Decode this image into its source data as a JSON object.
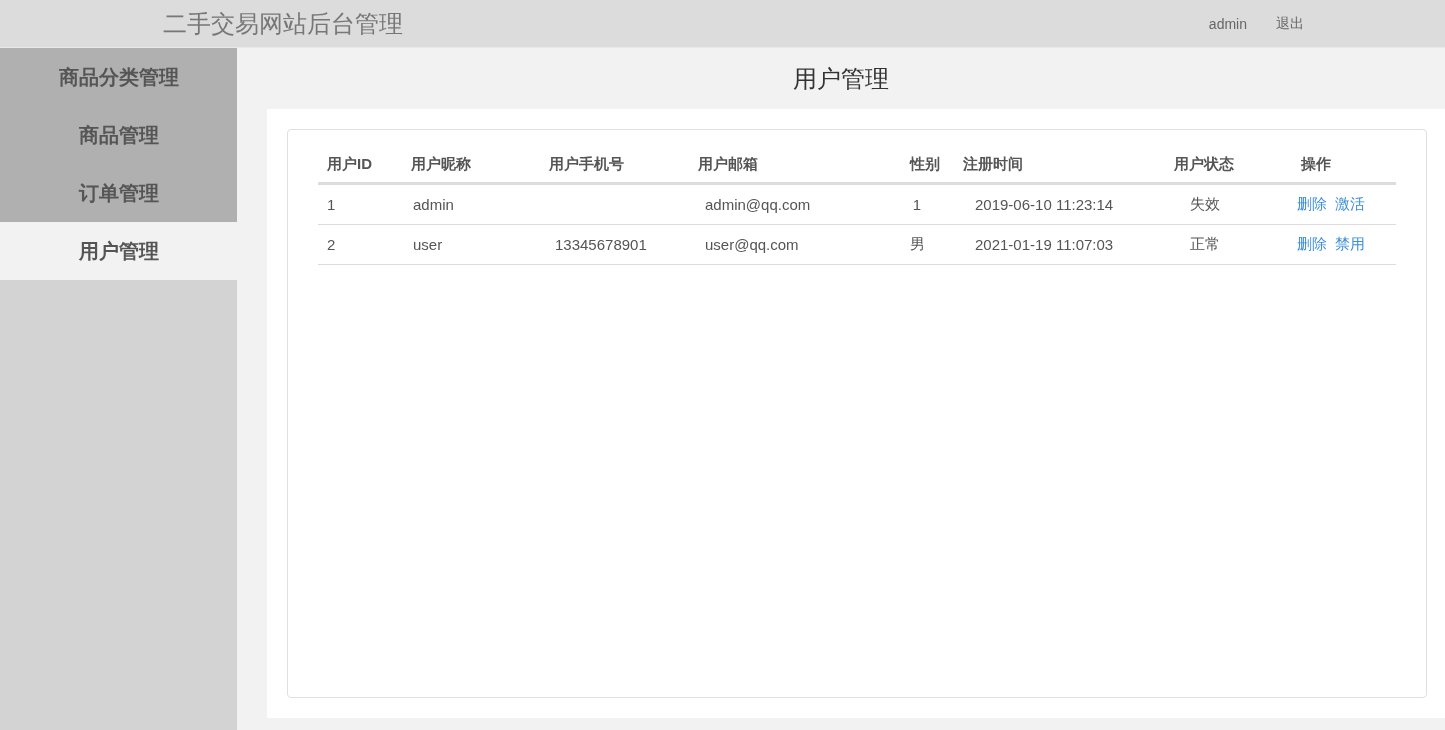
{
  "header": {
    "title": "二手交易网站后台管理",
    "user": "admin",
    "logout": "退出"
  },
  "sidebar": {
    "items": [
      {
        "label": "商品分类管理",
        "selected": false
      },
      {
        "label": "商品管理",
        "selected": false
      },
      {
        "label": "订单管理",
        "selected": false
      },
      {
        "label": "用户管理",
        "selected": true
      }
    ]
  },
  "page_title": "用户管理",
  "table": {
    "columns": [
      "用户ID",
      "用户昵称",
      "用户手机号",
      "用户邮箱",
      "性别",
      "注册时间",
      "用户状态",
      "操作"
    ],
    "rows": [
      {
        "cells": [
          "1",
          "admin",
          "",
          "admin@qq.com",
          "1",
          "2019-06-10 11:23:14",
          "失效"
        ],
        "actions": [
          "删除",
          "激活"
        ]
      },
      {
        "cells": [
          "2",
          "user",
          "13345678901",
          "user@qq.com",
          "男",
          "2021-01-19 11:07:03",
          "正常"
        ],
        "actions": [
          "删除",
          "禁用"
        ]
      }
    ]
  }
}
